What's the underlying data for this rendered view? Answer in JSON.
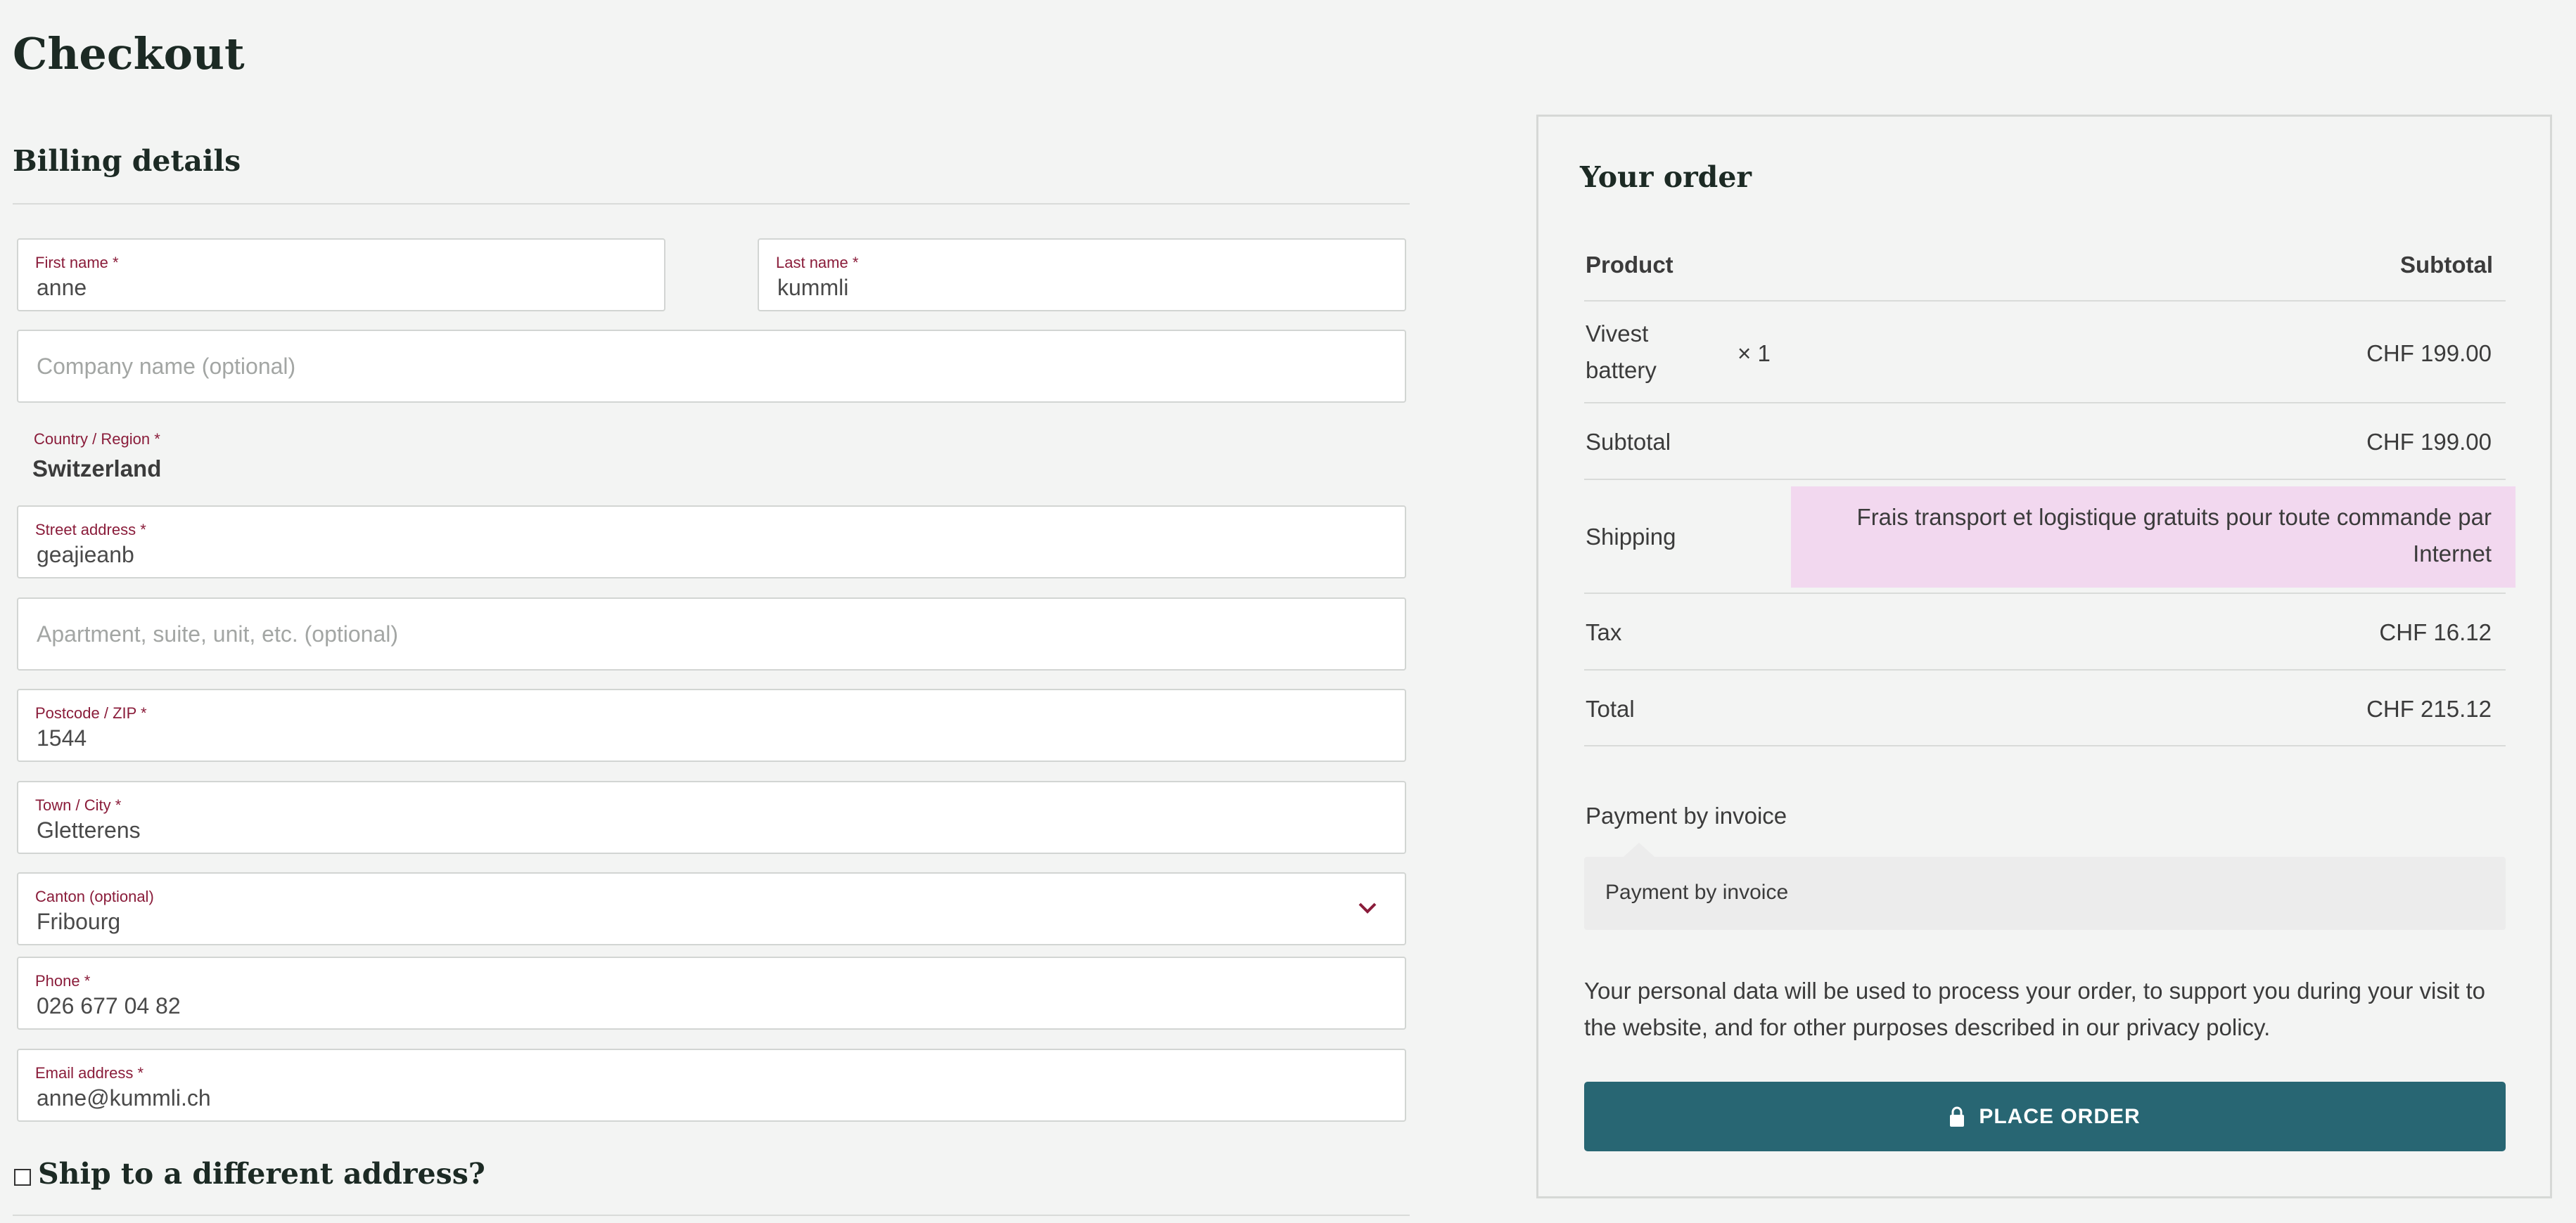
{
  "page": {
    "title": "Checkout"
  },
  "billing": {
    "title": "Billing details",
    "required_marker": "*",
    "first_name": {
      "label": "First name",
      "value": "anne"
    },
    "last_name": {
      "label": "Last name",
      "value": "kummli"
    },
    "company": {
      "placeholder": "Company name (optional)"
    },
    "country": {
      "label": "Country / Region",
      "value": "Switzerland"
    },
    "street": {
      "label": "Street address",
      "value": "geajieanb"
    },
    "apartment": {
      "placeholder": "Apartment, suite, unit, etc. (optional)"
    },
    "postcode": {
      "label": "Postcode / ZIP",
      "value": "1544"
    },
    "city": {
      "label": "Town / City",
      "value": "Gletterens"
    },
    "canton": {
      "label": "Canton (optional)",
      "value": "Fribourg"
    },
    "phone": {
      "label": "Phone",
      "value": "026 677 04 82"
    },
    "email": {
      "label": "Email address",
      "value": "anne@kummli.ch"
    },
    "ship_different": {
      "label": "Ship to a different address?",
      "checked": false
    }
  },
  "order": {
    "title": "Your order",
    "columns": {
      "product": "Product",
      "subtotal": "Subtotal"
    },
    "item": {
      "name_line1": "Vivest",
      "name_line2": "battery",
      "qty": "× 1",
      "price": "CHF 199.00"
    },
    "subtotal": {
      "label": "Subtotal",
      "value": "CHF 199.00"
    },
    "shipping": {
      "label": "Shipping",
      "value": "Frais transport et logistique gratuits pour toute commande par Internet"
    },
    "tax": {
      "label": "Tax",
      "value": "CHF 16.12"
    },
    "total": {
      "label": "Total",
      "value": "CHF 215.12"
    },
    "payment": {
      "method_label": "Payment by invoice",
      "description": "Payment by invoice"
    },
    "privacy_text": "Your personal data will be used to process your order, to support you during your visit to the website, and for other purposes described in our privacy policy.",
    "place_order_label": "PLACE ORDER",
    "lock_icon": "lock-icon"
  },
  "colors": {
    "accent": "#286673",
    "label_required": "#8a1c3a",
    "shipping_highlight": "#f2d8ef",
    "background": "#f3f4f3"
  }
}
